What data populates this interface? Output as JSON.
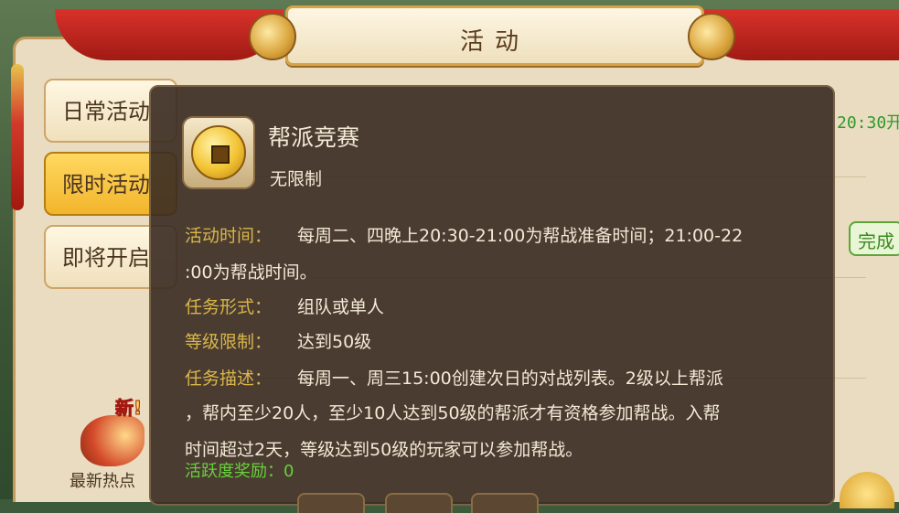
{
  "window": {
    "title": "活动"
  },
  "sidebar": {
    "tabs": [
      {
        "label": "日常活动",
        "active": false
      },
      {
        "label": "限时活动",
        "active": true
      },
      {
        "label": "即将开启",
        "active": false
      }
    ],
    "news": {
      "badge": "新!",
      "label": "最新热点"
    }
  },
  "background": {
    "time_hint": "20:30开",
    "done_hint": "完成"
  },
  "tooltip": {
    "name": "帮派竞赛",
    "limit": "无限制",
    "time_label": "活动时间：",
    "time_line1": "每周二、四晚上20:30-21:00为帮战准备时间；21:00-22",
    "time_line2": ":00为帮战时间。",
    "form_label": "任务形式：",
    "form_value": "组队或单人",
    "level_label": "等级限制：",
    "level_value": "达到50级",
    "desc_label": "任务描述：",
    "desc_line1": "每周一、周三15:00创建次日的对战列表。2级以上帮派",
    "desc_line2": "，帮内至少20人，至少10人达到50级的帮派才有资格参加帮战。入帮",
    "desc_line3": "时间超过2天，等级达到50级的玩家可以参加帮战。",
    "reward": "活跃度奖励：0",
    "icon": "gold-coin-icon"
  },
  "colors": {
    "label_gold": "#d9b64a",
    "text_light": "#f3ead6",
    "reward_green": "#66d23a",
    "active_tab": "#f2b52c"
  }
}
